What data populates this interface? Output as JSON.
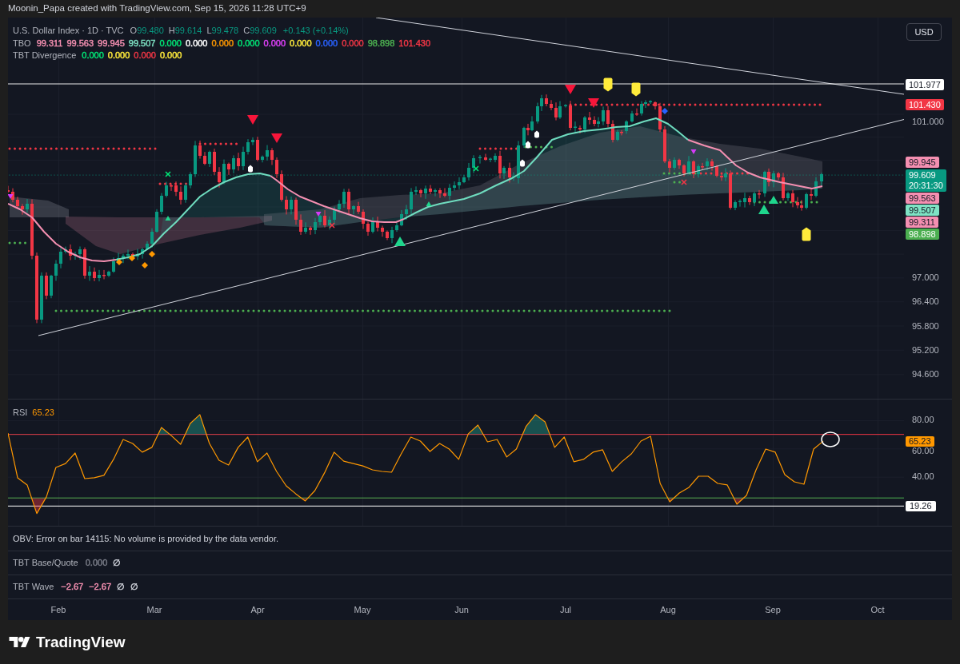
{
  "header": {
    "text": "Moonin_Papa created with TradingView.com, Sep 15, 2026 11:28 UTC+9"
  },
  "main_pane": {
    "legend": {
      "symbol": "U.S. Dollar Index · 1D · TVC",
      "ohlc": [
        {
          "label": "O",
          "value": "99.480"
        },
        {
          "label": "H",
          "value": "99.614"
        },
        {
          "label": "L",
          "value": "99.478"
        },
        {
          "label": "C",
          "value": "99.609"
        }
      ],
      "change": "+0.143 (+0.14%)",
      "indicators": [
        {
          "name": "TBO",
          "values": [
            {
              "text": "99.311",
              "color": "#f48fb1"
            },
            {
              "text": "99.563",
              "color": "#f48fb1"
            },
            {
              "text": "99.945",
              "color": "#f48fb1"
            },
            {
              "text": "99.507",
              "color": "#7ee3c4"
            },
            {
              "text": "0.000",
              "color": "#00e676"
            },
            {
              "text": "0.000",
              "color": "#ffffff"
            },
            {
              "text": "0.000",
              "color": "#ff9800"
            },
            {
              "text": "0.000",
              "color": "#00e676"
            },
            {
              "text": "0.000",
              "color": "#e040fb"
            },
            {
              "text": "0.000",
              "color": "#ffeb3b"
            },
            {
              "text": "0.000",
              "color": "#2962ff"
            },
            {
              "text": "0.000",
              "color": "#f23645"
            },
            {
              "text": "98.898",
              "color": "#4caf50"
            },
            {
              "text": "101.430",
              "color": "#f23645"
            }
          ]
        },
        {
          "name": "TBT Divergence",
          "values": [
            {
              "text": "0.000",
              "color": "#00e676"
            },
            {
              "text": "0.000",
              "color": "#ffeb3b"
            },
            {
              "text": "0.000",
              "color": "#f23645"
            },
            {
              "text": "0.000",
              "color": "#ffeb3b"
            }
          ]
        }
      ]
    },
    "currency_button": "USD",
    "price_axis": [
      {
        "kind": "badge",
        "text": "101.977",
        "color": "#ffffff"
      },
      {
        "kind": "badge",
        "text": "101.430",
        "color": "#f23645"
      },
      {
        "kind": "tick",
        "text": "101.000"
      },
      {
        "kind": "badge",
        "text": "99.945",
        "color": "#f48fb1"
      },
      {
        "kind": "badge",
        "text": "99.609",
        "subtext": "20:31:30",
        "color": "#089981"
      },
      {
        "kind": "badge",
        "text": "99.563",
        "color": "#f48fb1"
      },
      {
        "kind": "badge",
        "text": "99.507",
        "color": "#7ee3c4"
      },
      {
        "kind": "badge",
        "text": "99.311",
        "color": "#f48fb1"
      },
      {
        "kind": "badge",
        "text": "98.898",
        "color": "#4caf50"
      },
      {
        "kind": "tick",
        "text": "97.000"
      },
      {
        "kind": "tick",
        "text": "96.400"
      },
      {
        "kind": "tick",
        "text": "95.800"
      },
      {
        "kind": "tick",
        "text": "95.200"
      },
      {
        "kind": "tick",
        "text": "94.600"
      }
    ]
  },
  "rsi_pane": {
    "legend": {
      "value": "65.23"
    },
    "value_badge": "65.23",
    "chart_data": {
      "type": "line",
      "ylim": [
        5.3,
        94.7
      ],
      "yticks": [
        {
          "value": 80,
          "label": "80.00"
        },
        {
          "value": 60,
          "label": "60.00"
        },
        {
          "value": 40,
          "label": "40.00"
        }
      ],
      "series": [
        {
          "name": "RSI",
          "color": "#ff9800",
          "values": [
            70.9,
            39.3,
            34.2,
            14.0,
            25.7,
            46.6,
            49.4,
            56.8,
            38.7,
            39.3,
            41.0,
            52.3,
            66.4,
            63.6,
            57.4,
            60.8,
            74.9,
            69.3,
            63.0,
            77.7,
            84.0,
            63.6,
            51.7,
            48.3,
            60.8,
            68.1,
            50.6,
            56.8,
            43.8,
            33.6,
            28.0,
            22.9,
            30.2,
            42.7,
            57.4,
            51.1,
            49.4,
            47.7,
            44.9,
            43.8,
            43.2,
            56.2,
            68.1,
            65.3,
            57.9,
            63.6,
            59.6,
            52.3,
            70.4,
            76.6,
            64.7,
            66.4,
            54.0,
            59.6,
            75.5,
            84.0,
            78.9,
            60.8,
            68.1,
            50.6,
            52.3,
            57.4,
            59.1,
            43.8,
            50.6,
            56.2,
            65.3,
            68.7,
            35.3,
            22.3,
            28.5,
            32.5,
            40.4,
            40.4,
            35.3,
            34.2,
            20.6,
            26.8,
            44.9,
            59.6,
            57.4,
            41.5,
            36.4,
            34.7,
            59.6,
            65.2
          ]
        }
      ],
      "ref_lines": [
        {
          "axis": "y",
          "value": 70,
          "color": "#f23645"
        },
        {
          "axis": "y",
          "value": 25,
          "color": "#4caf50"
        },
        {
          "axis": "y",
          "value": 19.26,
          "color": "#ffffff",
          "label": "19.26"
        }
      ]
    }
  },
  "lower_panes": [
    {
      "kind": "message",
      "text": "OBV: Error on bar 14115: No volume is provided by the data vendor."
    },
    {
      "kind": "indicator",
      "name": "TBT Base/Quote",
      "values": [
        {
          "text": "0.000",
          "color": "#787b86"
        },
        {
          "text": "∅",
          "color": "#d1d4dc"
        }
      ]
    },
    {
      "kind": "indicator",
      "name": "TBT Wave",
      "values": [
        {
          "text": "−2.67",
          "color": "#f48fb1"
        },
        {
          "text": "−2.67",
          "color": "#f48fb1"
        },
        {
          "text": "∅",
          "color": "#d1d4dc"
        },
        {
          "text": "∅",
          "color": "#d1d4dc"
        }
      ]
    }
  ],
  "time_axis": [
    "Feb",
    "Mar",
    "Apr",
    "May",
    "Jun",
    "Jul",
    "Aug",
    "Sep",
    "Oct"
  ],
  "footer": {
    "logo_text": "TradingView"
  }
}
